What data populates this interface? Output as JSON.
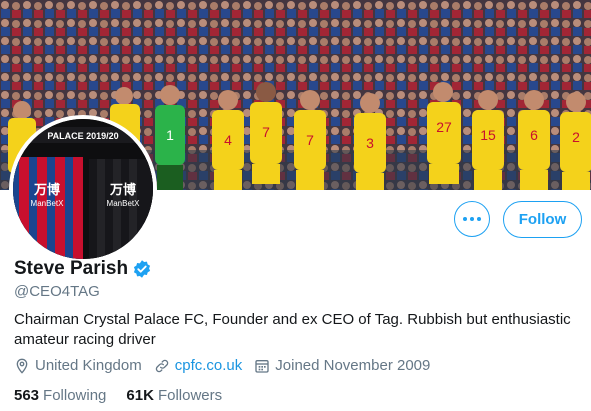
{
  "banner": {
    "caption": "PALACE 2019/20"
  },
  "players": [
    "4",
    "7",
    "7",
    "3",
    "27",
    "15",
    "6",
    "2",
    "1"
  ],
  "avatar": {
    "shirt_sponsor": "万博 ManBetX",
    "sponsor_left": "万博",
    "sponsor_left_sub": "ManBetX",
    "sponsor_right": "万博",
    "sponsor_right_sub": "ManBetX",
    "caption": "PALACE 2019/20"
  },
  "actions": {
    "more_icon": "more-horizontal-icon",
    "follow_label": "Follow"
  },
  "profile": {
    "name": "Steve Parish",
    "handle": "@CEO4TAG",
    "bio_line1": "Chairman Crystal Palace FC, Founder and ex CEO of Tag. Rubbish but enthusiastic",
    "bio_line2": "amateur racing driver",
    "location": "United Kingdom",
    "website": "cpfc.co.uk",
    "joined": "Joined November 2009"
  },
  "stats": {
    "following_count": "563",
    "following_label": "Following",
    "followers_count": "61K",
    "followers_label": "Followers"
  },
  "colors": {
    "accent": "#1da1f2",
    "palace_yellow": "#f4d21b",
    "palace_red": "#c8102e",
    "palace_blue": "#1b458f"
  }
}
